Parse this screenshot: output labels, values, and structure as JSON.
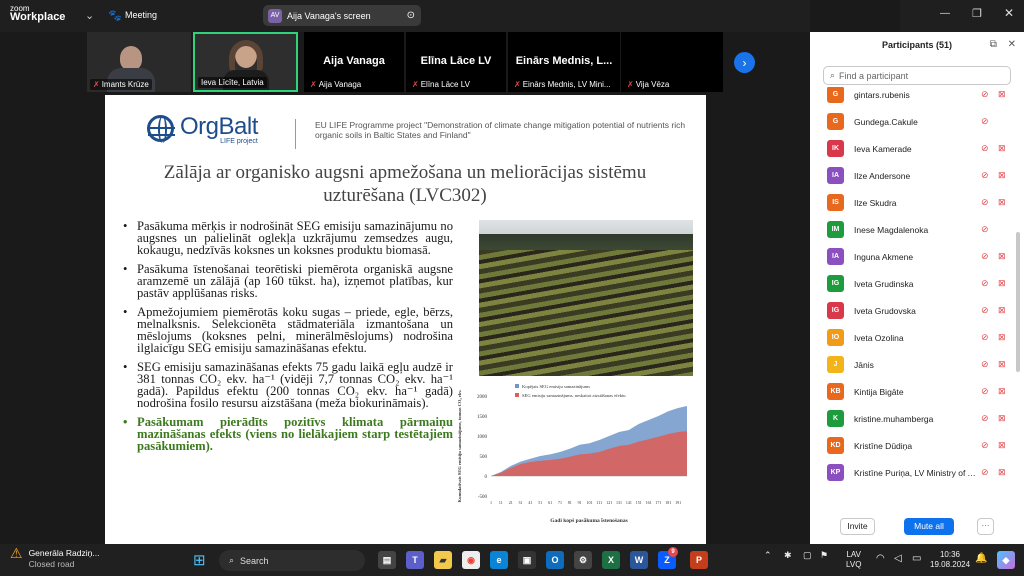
{
  "topbar": {
    "app_name_small": "zoom",
    "app_name": "Workplace",
    "meeting_label": "Meeting",
    "screen_badge": "AV",
    "screen_label": "Aija Vanaga's screen"
  },
  "participants_strip": [
    {
      "name": "Imants Krūze",
      "muted": true
    },
    {
      "name": "Ieva Līcīte, Latvia",
      "muted": false
    },
    {
      "name": "Aija Vanaga",
      "big_name": "Aija Vanaga",
      "muted": true
    },
    {
      "name": "Elīna Lāce LV",
      "big_name": "Elīna Lāce LV",
      "muted": true
    },
    {
      "name": "Einārs Mednis, LV Mini...",
      "big_name": "Einārs Mednis, L...",
      "muted": true
    },
    {
      "name": "Vija Vēza",
      "muted": true
    }
  ],
  "slide": {
    "brand_main": "OrgBalt",
    "brand_sub": "LIFE project",
    "eu_text": "EU LIFE Programme project \"Demonstration of climate change mitigation potential of nutrients rich organic soils in Baltic States and Finland\"",
    "title": "Zālāja ar organisko augsni apmežošana un meliorācijas sistēmu uzturēšana (LVC302)",
    "bullets": [
      "Pasākuma mērķis ir nodrošināt SEG emisiju samazinājumu no augsnes un palielināt oglekļa uzkrājumu zemsedzes augu, kokaugu, nedzīvās koksnes un koksnes produktu biomasā.",
      "Pasākuma īstenošanai teorētiski piemērota organiskā augsne aramzemē un zālājā (ap 160 tūkst. ha), izņemot platības, kur pastāv applūšanas risks.",
      "Apmežojumiem piemērotās koku sugas – priede, egle, bērzs, melnalksnis. Selekcionēta stādmateriāla izmantošana un mēslojums (koksnes pelni, minerālmēslojums) nodrošina ilglaicīgu SEG emisiju samazināšanas efektu.",
      "SEG emisiju samazināšanas efekts 75 gadu laikā egļu audzē ir 381 tonnas CO₂ ekv. ha⁻¹ (vidēji 7,7 tonnas CO₂ ekv. ha⁻¹ gadā). Papildus efektu (200 tonnas CO₂ ekv. ha⁻¹ gadā) nodrošina fosilo resursu aizstāšana (meža biokurināmais).",
      "Pasākumam pierādīts pozitīvs klimata pārmaiņu mazināšanas efekts (viens no lielākajiem starp testētajiem pasākumiem)."
    ]
  },
  "chart_data": {
    "type": "area",
    "legend": [
      "Kopējais SEG emisiju samazinājums",
      "SEG emisiju samazinājums, neskaitot aizstāšanas efektu"
    ],
    "xlabel": "Gadi kopš pasākuma īstenošanas",
    "ylabel": "Kumulatīvais SEG emisiju samazinājums, tonnas CO₂ ekv.",
    "yticks": [
      "2000",
      "1500",
      "1000",
      "500",
      "0",
      "-500"
    ],
    "ylim": [
      -500,
      2000
    ],
    "xticks": [
      "1",
      "11",
      "21",
      "31",
      "41",
      "51",
      "61",
      "71",
      "81",
      "91",
      "101",
      "111",
      "121",
      "131",
      "141",
      "151",
      "161",
      "171",
      "181",
      "191"
    ],
    "x": [
      1,
      11,
      21,
      31,
      41,
      51,
      61,
      71,
      81,
      91,
      101,
      111,
      121,
      131,
      141,
      151,
      161,
      171,
      181,
      191,
      200
    ],
    "series": [
      {
        "name": "Kopējais SEG emisiju samazinājums",
        "values": [
          0,
          100,
          250,
          360,
          430,
          500,
          540,
          600,
          680,
          780,
          820,
          900,
          1000,
          1100,
          1150,
          1300,
          1400,
          1500,
          1620,
          1700,
          1750
        ],
        "color": "#6f97c8"
      },
      {
        "name": "SEG emisiju samazinājums, neskaitot aizstāšanas efektu",
        "values": [
          0,
          80,
          200,
          300,
          350,
          380,
          400,
          430,
          480,
          540,
          560,
          600,
          680,
          750,
          780,
          860,
          920,
          980,
          1050,
          1100,
          1120
        ],
        "color": "#d9615a"
      }
    ]
  },
  "sidebar": {
    "title": "Participants (51)",
    "search_placeholder": "Find a participant",
    "participants": [
      {
        "initials": "G",
        "name": "gintars.rubenis",
        "color": "#e8691e",
        "cam_off": true
      },
      {
        "initials": "G",
        "name": "Gundega.Cakule",
        "color": "#e8691e",
        "cam_off": false
      },
      {
        "initials": "IK",
        "name": "Ieva Kamerade",
        "color": "#d9384a",
        "cam_off": true
      },
      {
        "initials": "IA",
        "name": "Ilze Andersone",
        "color": "#8b4fc0",
        "cam_off": true
      },
      {
        "initials": "IS",
        "name": "Ilze Skudra",
        "color": "#e8691e",
        "cam_off": true
      },
      {
        "initials": "IM",
        "name": "Inese Magdalenoka",
        "color": "#1e9c3d",
        "cam_off": false
      },
      {
        "initials": "IA",
        "name": "Inguna Akmene",
        "color": "#8b4fc0",
        "cam_off": true
      },
      {
        "initials": "IG",
        "name": "Iveta Grudinska",
        "color": "#1e9c3d",
        "cam_off": true
      },
      {
        "initials": "IG",
        "name": "Iveta Grudovska",
        "color": "#d9384a",
        "cam_off": true
      },
      {
        "initials": "IO",
        "name": "Iveta Ozolina",
        "color": "#f29b18",
        "cam_off": true
      },
      {
        "initials": "J",
        "name": "Jānis",
        "color": "#f2b418",
        "cam_off": true
      },
      {
        "initials": "KB",
        "name": "Kintija Bigāte",
        "color": "#e8691e",
        "cam_off": true
      },
      {
        "initials": "K",
        "name": "kristine.muhamberga",
        "color": "#1e9c3d",
        "cam_off": true
      },
      {
        "initials": "KD",
        "name": "Kristīne Dūdiņa",
        "color": "#e8691e",
        "cam_off": true
      },
      {
        "initials": "KP",
        "name": "Kristīne Puriņa, LV Ministry of Ag...",
        "color": "#8b4fc0",
        "cam_off": true
      }
    ],
    "invite_label": "Invite",
    "mute_all_label": "Mute all",
    "more_label": "···"
  },
  "taskbar": {
    "weather_title": "Generāla Radziņ...",
    "weather_sub": "Closed road",
    "search_label": "Search",
    "lang_top": "LAV",
    "lang_bottom": "LVQ",
    "time": "10:36",
    "date": "19.08.2024",
    "teams_badge": "9"
  }
}
